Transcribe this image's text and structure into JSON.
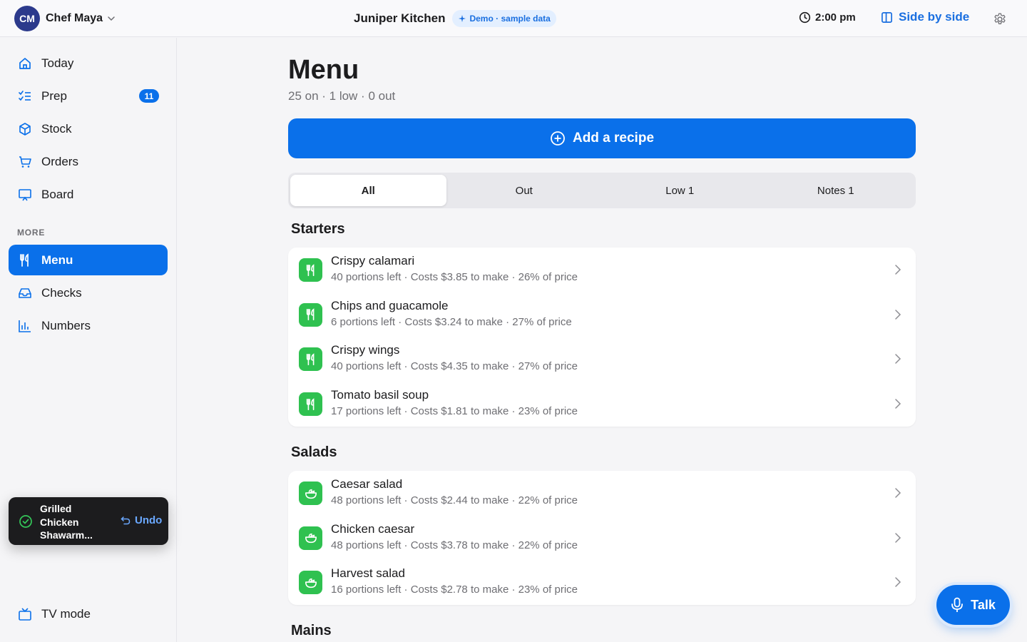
{
  "header": {
    "avatar_initials": "CM",
    "user_name": "Chef Maya",
    "restaurant": "Juniper Kitchen",
    "demo_badge": "Demo · sample data",
    "time": "2:00 pm",
    "side_by_side": "Side by side"
  },
  "sidebar": {
    "items": [
      {
        "label": "Today",
        "icon": "home-icon"
      },
      {
        "label": "Prep",
        "icon": "checklist-icon",
        "badge": "11"
      },
      {
        "label": "Stock",
        "icon": "box-icon"
      },
      {
        "label": "Orders",
        "icon": "cart-icon"
      },
      {
        "label": "Board",
        "icon": "presentation-icon"
      }
    ],
    "more_label": "MORE",
    "more_items": [
      {
        "label": "Menu",
        "icon": "utensils-icon",
        "active": true
      },
      {
        "label": "Checks",
        "icon": "inbox-icon"
      },
      {
        "label": "Numbers",
        "icon": "bar-chart-icon"
      }
    ],
    "tv_mode": "TV mode"
  },
  "toast": {
    "message": "Grilled Chicken Shawarm...",
    "undo": "Undo"
  },
  "main": {
    "title": "Menu",
    "summary": "25 on · 1 low · 0 out",
    "add_button": "Add a recipe",
    "tabs": [
      "All",
      "Out",
      "Low 1",
      "Notes 1"
    ],
    "active_tab": "All",
    "sections": [
      {
        "title": "Starters",
        "icon": "utensils-icon",
        "items": [
          {
            "name": "Crispy calamari",
            "meta": "40 portions left · Costs $3.85 to make · 26% of price"
          },
          {
            "name": "Chips and guacamole",
            "meta": "6 portions left · Costs $3.24 to make · 27% of price"
          },
          {
            "name": "Crispy wings",
            "meta": "40 portions left · Costs $4.35 to make · 27% of price"
          },
          {
            "name": "Tomato basil soup",
            "meta": "17 portions left · Costs $1.81 to make · 23% of price"
          }
        ]
      },
      {
        "title": "Salads",
        "icon": "salad-icon",
        "items": [
          {
            "name": "Caesar salad",
            "meta": "48 portions left · Costs $2.44 to make · 22% of price"
          },
          {
            "name": "Chicken caesar",
            "meta": "48 portions left · Costs $3.78 to make · 22% of price"
          },
          {
            "name": "Harvest salad",
            "meta": "16 portions left · Costs $2.78 to make · 23% of price"
          }
        ]
      },
      {
        "title": "Mains",
        "items": []
      }
    ]
  },
  "talk_button": "Talk",
  "colors": {
    "accent": "#0a70ea",
    "tile_green": "#2fc150",
    "avatar": "#2c3a8c"
  }
}
